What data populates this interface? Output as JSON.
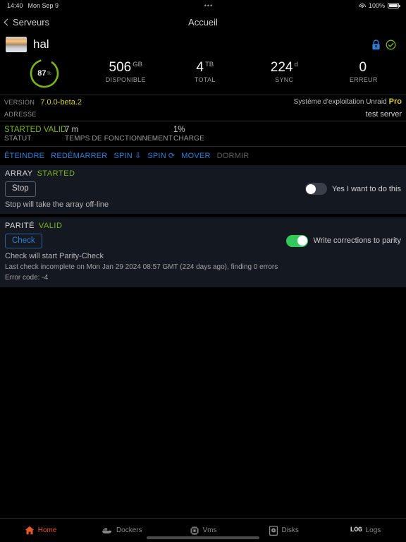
{
  "statusbar": {
    "time": "14:40",
    "date": "Mon Sep 9",
    "center": "•••",
    "battery": "100%"
  },
  "navbar": {
    "back_label": "Serveurs",
    "title": "Accueil"
  },
  "header": {
    "server_name": "hal",
    "lock_icon": "lock-icon",
    "status_icon": "check-circle-icon",
    "lock_color": "#2f7fd6",
    "status_color": "#7cb518"
  },
  "stats": {
    "donut": {
      "value": "87",
      "unit": "%",
      "percent": 87,
      "color": "#7cb518"
    },
    "items": [
      {
        "value": "506",
        "unit": "GB",
        "label": "DISPONIBLE"
      },
      {
        "value": "4",
        "unit": "TB",
        "label": "TOTAL"
      },
      {
        "value": "224",
        "unit": "d",
        "label": "SYNC"
      },
      {
        "value": "0",
        "unit": "",
        "label": "ERREUR"
      }
    ]
  },
  "info": {
    "version_label": "VERSION",
    "version_value": "7.0.0-beta.2",
    "os_label": "Système d'exploitation Unraid",
    "os_tier": "Pro",
    "address_label": "ADRESSE",
    "address_value": "test server"
  },
  "status": {
    "array_state": "STARTED",
    "parity_state": "VALID",
    "status_label": "STATUT",
    "uptime_value": "7 m",
    "uptime_label": "TEMPS DE FONCTIONNEMENT",
    "load_value": "1%",
    "load_label": "CHARGE"
  },
  "actions": [
    {
      "label": "ÉTEINDRE",
      "icon": "",
      "disabled": false
    },
    {
      "label": "REDÉMARRER",
      "icon": "",
      "disabled": false
    },
    {
      "label": "SPIN",
      "icon": "⇩",
      "disabled": false
    },
    {
      "label": "SPIN",
      "icon": "⟳",
      "disabled": false
    },
    {
      "label": "MOVER",
      "icon": "",
      "disabled": false
    },
    {
      "label": "DORMIR",
      "icon": "",
      "disabled": true
    }
  ],
  "array_panel": {
    "title": "ARRAY",
    "state": "STARTED",
    "button_label": "Stop",
    "toggle_on": false,
    "toggle_label": "Yes I want to do this",
    "note": "Stop will take the array off-line"
  },
  "parity_panel": {
    "title": "PARITÉ",
    "state": "VALID",
    "button_label": "Check",
    "toggle_on": true,
    "toggle_label": "Write corrections to parity",
    "note": "Check will start Parity-Check",
    "subnote_1": "Last check incomplete on Mon Jan 29 2024 08:57 GMT (224 days ago), finding 0 errors",
    "subnote_2": "Error code: -4"
  },
  "tabs": [
    {
      "label": "Home",
      "icon": "home-icon",
      "active": true
    },
    {
      "label": "Dockers",
      "icon": "whale-icon",
      "active": false
    },
    {
      "label": "Vms",
      "icon": "chip-icon",
      "active": false
    },
    {
      "label": "Disks",
      "icon": "harddrive-icon",
      "active": false
    },
    {
      "label": "Logs",
      "icon": "log-icon",
      "active": false
    }
  ],
  "accent": {
    "active_tab": "#e8562a",
    "link": "#2f7fd6",
    "ok": "#7cb518",
    "warn": "#d8cf3a"
  }
}
